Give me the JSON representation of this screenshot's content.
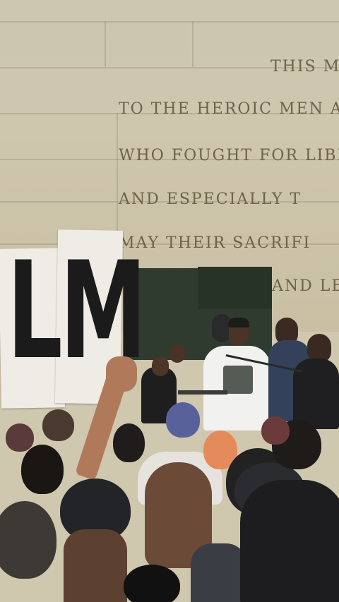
{
  "scene": {
    "description_kind": "photo",
    "inscription_lines": [
      "THIS M",
      "TO THE HEROIC MEN AN",
      "WHO FOUGHT FOR LIBE",
      "AND ESPECIALLY T",
      "MAY THEIR SACRIFI",
      "AND LE"
    ],
    "sign_text": "LM"
  },
  "colors": {
    "wall": "#cdc6b0",
    "inscription": "#6e6247",
    "panel": "#2f3b2e",
    "sign": "#efece6",
    "sign_ink": "#1b1b1b"
  }
}
